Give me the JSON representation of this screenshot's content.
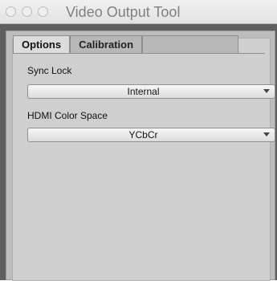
{
  "window": {
    "title": "Video Output Tool"
  },
  "tabs": [
    {
      "label": "Options",
      "active": true
    },
    {
      "label": "Calibration",
      "active": false
    }
  ],
  "fields": {
    "sync_lock": {
      "label": "Sync Lock",
      "value": "Internal"
    },
    "hdmi_color_space": {
      "label": "HDMI Color Space",
      "value": "YCbCr"
    }
  }
}
